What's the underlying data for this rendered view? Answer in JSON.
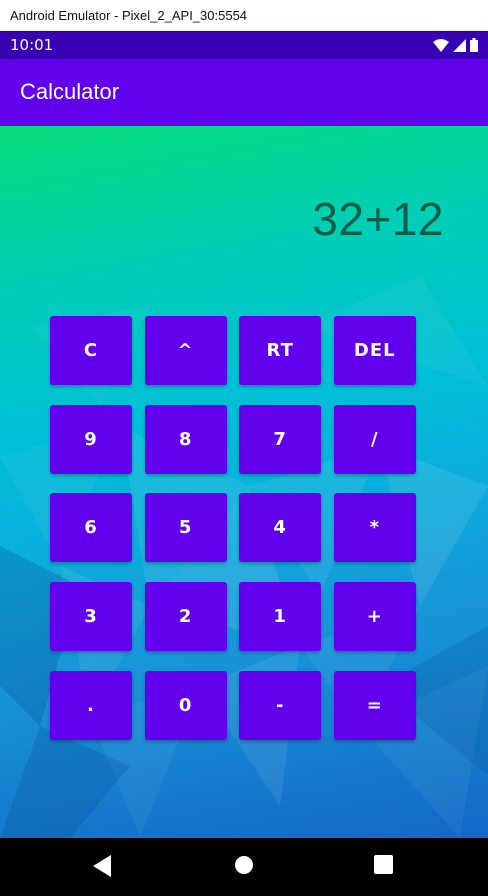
{
  "window": {
    "title": "Android Emulator - Pixel_2_API_30:5554"
  },
  "status_bar": {
    "time": "10:01",
    "icons": [
      "wifi-icon",
      "signal-icon",
      "battery-icon"
    ]
  },
  "app_bar": {
    "title": "Calculator"
  },
  "display": {
    "expression": "32+12"
  },
  "keypad": {
    "rows": [
      [
        "C",
        "^",
        "RT",
        "DEL"
      ],
      [
        "9",
        "8",
        "7",
        "/"
      ],
      [
        "6",
        "5",
        "4",
        "*"
      ],
      [
        "3",
        "2",
        "1",
        "+"
      ],
      [
        ".",
        "0",
        "-",
        "="
      ]
    ]
  },
  "nav_bar": {
    "buttons": [
      "back-icon",
      "home-icon",
      "recents-icon"
    ]
  },
  "colors": {
    "status_bar": "#3700b3",
    "app_bar": "#6200ee",
    "button": "#6200ee",
    "display_text": "#0b5e4a"
  }
}
